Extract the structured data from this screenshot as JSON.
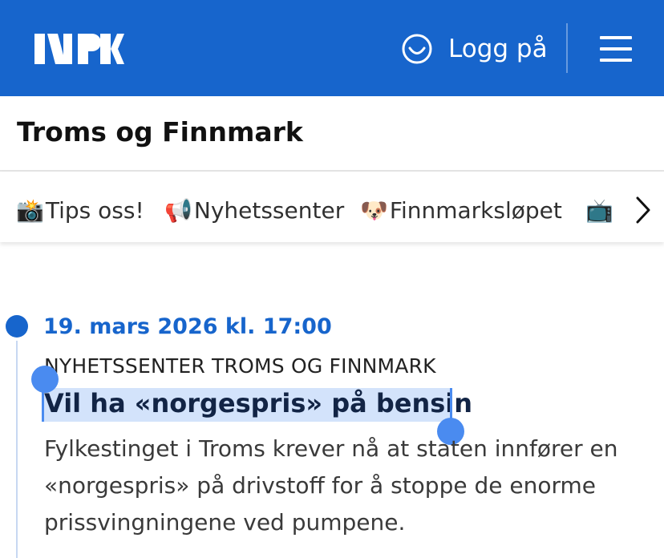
{
  "header": {
    "logo_text": "NRK",
    "login_label": "Logg på",
    "brand_color": "#1765CC"
  },
  "region": {
    "title": "Troms og Finnmark"
  },
  "chips": [
    {
      "emoji": "📸",
      "label": "Tips oss!"
    },
    {
      "emoji": "📢",
      "label": "Nyhetssenter"
    },
    {
      "emoji": "🐶",
      "label": "Finnmarksløpet"
    },
    {
      "emoji": "📺",
      "label": ""
    }
  ],
  "article": {
    "date": "19. mars 2026 kl. 17:00",
    "kicker": "NYHETSSENTER TROMS OG FINNMARK",
    "headline": "Vil ha «norgespris» på bensin",
    "lead": "Fylkestinget i Troms krever nå at staten innfører en «norgespris» på drivstoff for å stoppe de enorme prissvingningene ved pumpene."
  }
}
